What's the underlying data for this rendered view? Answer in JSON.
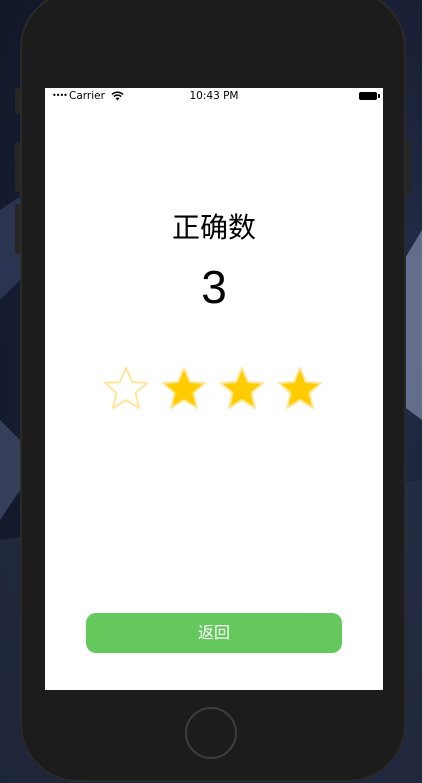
{
  "status_bar": {
    "carrier": "Carrier",
    "time": "10:43 PM",
    "signal_icon": "signal-dots-icon",
    "wifi_icon": "wifi-icon",
    "battery_icon": "battery-icon"
  },
  "result": {
    "title": "正确数",
    "count": "3"
  },
  "rating": {
    "filled": 3,
    "total": 4,
    "filled_color": "#FFCC00",
    "empty_color": "#FFE79A"
  },
  "actions": {
    "back_label": "返回",
    "back_color": "#64C85C"
  }
}
